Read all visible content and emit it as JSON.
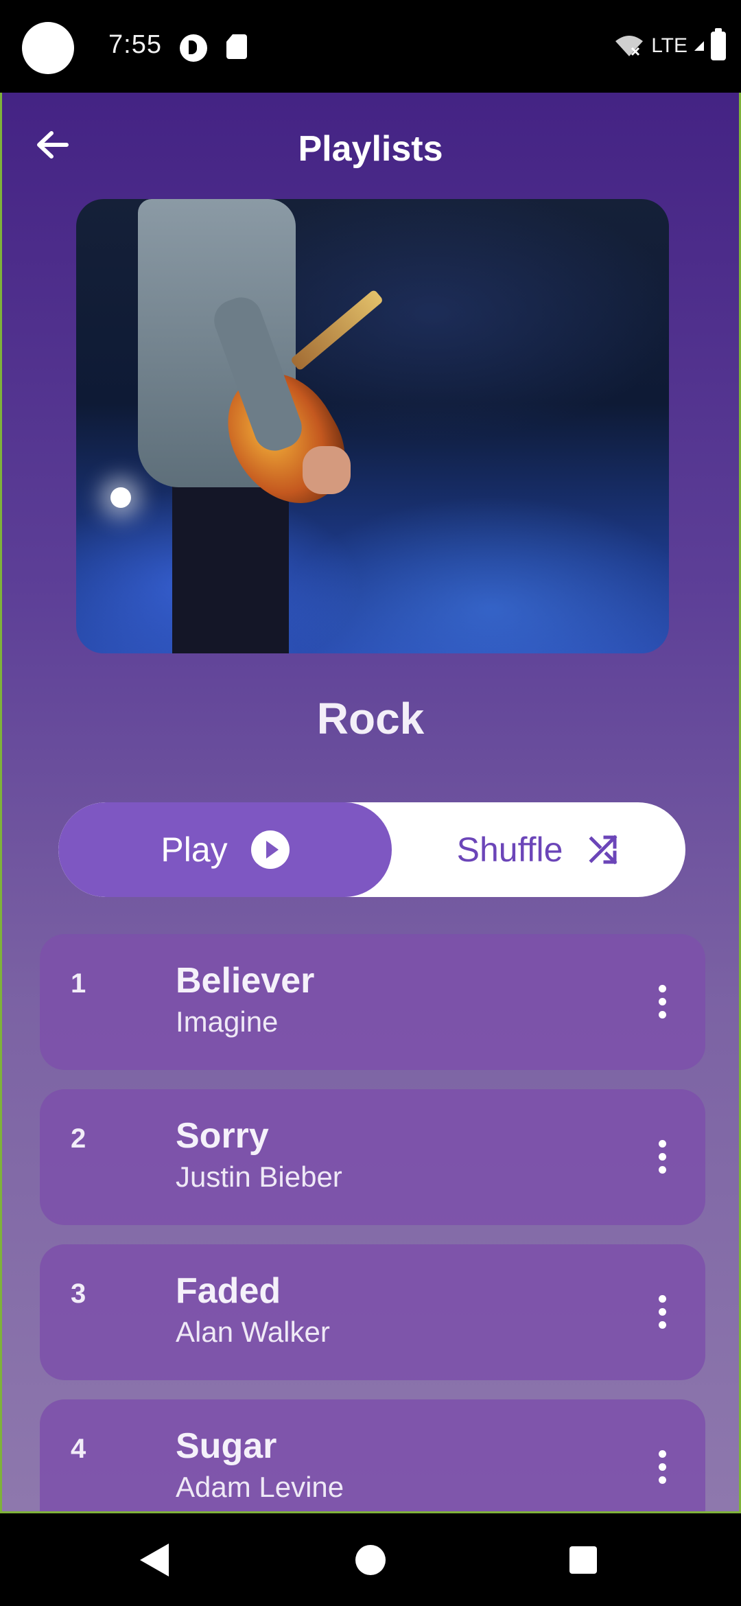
{
  "status_bar": {
    "time": "7:55",
    "network": "LTE",
    "icons": [
      "camera-cutout",
      "tasker-icon",
      "sd-card-icon",
      "wifi-off-icon",
      "signal-icon",
      "battery-icon"
    ]
  },
  "header": {
    "title": "Playlists",
    "back_icon": "arrow-left-icon"
  },
  "playlist": {
    "name": "Rock",
    "cover_description_icon": "guitarist-on-stage-image"
  },
  "controls": {
    "play_label": "Play",
    "play_icon": "play-circle-icon",
    "shuffle_label": "Shuffle",
    "shuffle_icon": "shuffle-icon",
    "active": "play"
  },
  "tracks": [
    {
      "number": "1",
      "title": "Believer",
      "artist": "Imagine"
    },
    {
      "number": "2",
      "title": "Sorry",
      "artist": "Justin Bieber"
    },
    {
      "number": "3",
      "title": "Faded",
      "artist": "Alan Walker"
    },
    {
      "number": "4",
      "title": "Sugar",
      "artist": "Adam Levine"
    }
  ],
  "colors": {
    "accent": "#7e57c2",
    "shuffle_text": "#6b45b8",
    "background_top": "#442384",
    "background_bottom": "#8e78ad"
  },
  "nav_bar": {
    "buttons": [
      "back-triangle-icon",
      "home-circle-icon",
      "recents-square-icon"
    ]
  }
}
